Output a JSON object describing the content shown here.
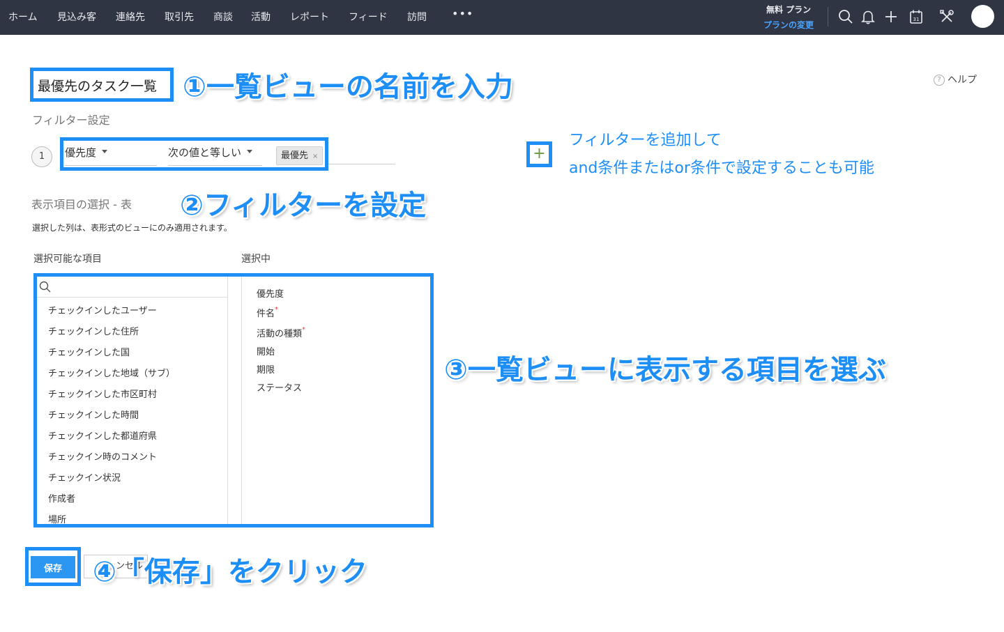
{
  "nav": {
    "items": [
      "ホーム",
      "見込み客",
      "連絡先",
      "取引先",
      "商談",
      "活動",
      "レポート",
      "フィード",
      "訪問"
    ],
    "more": "•••",
    "plan_name": "無料 プラン",
    "plan_change": "プランの変更",
    "calendar_day": "31"
  },
  "view_name": {
    "value": "最優先のタスク一覧"
  },
  "help": {
    "label": "ヘルプ",
    "icon_glyph": "?"
  },
  "filter": {
    "section_title": "フィルター設定",
    "number": "1",
    "field": "優先度",
    "operator": "次の値と等しい",
    "value_chip": "最優先",
    "chip_remove": "×",
    "add_button": "+"
  },
  "columns": {
    "section_title": "表示項目の選択 - 表",
    "note": "選択した列は、表形式のビューにのみ適用されます。",
    "available_label": "選択可能な項目",
    "selected_label": "選択中",
    "available": [
      "チェックインしたユーザー",
      "チェックインした住所",
      "チェックインした国",
      "チェックインした地域（サブ）",
      "チェックインした市区町村",
      "チェックインした時間",
      "チェックインした都道府県",
      "チェックイン時のコメント",
      "チェックイン状況",
      "作成者",
      "場所"
    ],
    "selected": [
      {
        "label": "優先度",
        "required": false
      },
      {
        "label": "件名",
        "required": true
      },
      {
        "label": "活動の種類",
        "required": true
      },
      {
        "label": "開始",
        "required": false
      },
      {
        "label": "期限",
        "required": false
      },
      {
        "label": "ステータス",
        "required": false
      }
    ],
    "required_mark": "*"
  },
  "buttons": {
    "save": "保存",
    "cancel": "キャンセル"
  },
  "annotations": {
    "step1": "①一覧ビューの名前を入力",
    "step2": "②フィルターを設定",
    "step3": "③一覧ビューに表示する項目を選ぶ",
    "step4": "④「保存」をクリック",
    "note_line1": "フィルターを追加して",
    "note_line2": "and条件またはor条件で設定することも可能"
  },
  "colors": {
    "nav_bg": "#2f3542",
    "accent": "#1e8ef7",
    "save_button": "#2c97f2",
    "plan_link": "#4aa3ff"
  }
}
